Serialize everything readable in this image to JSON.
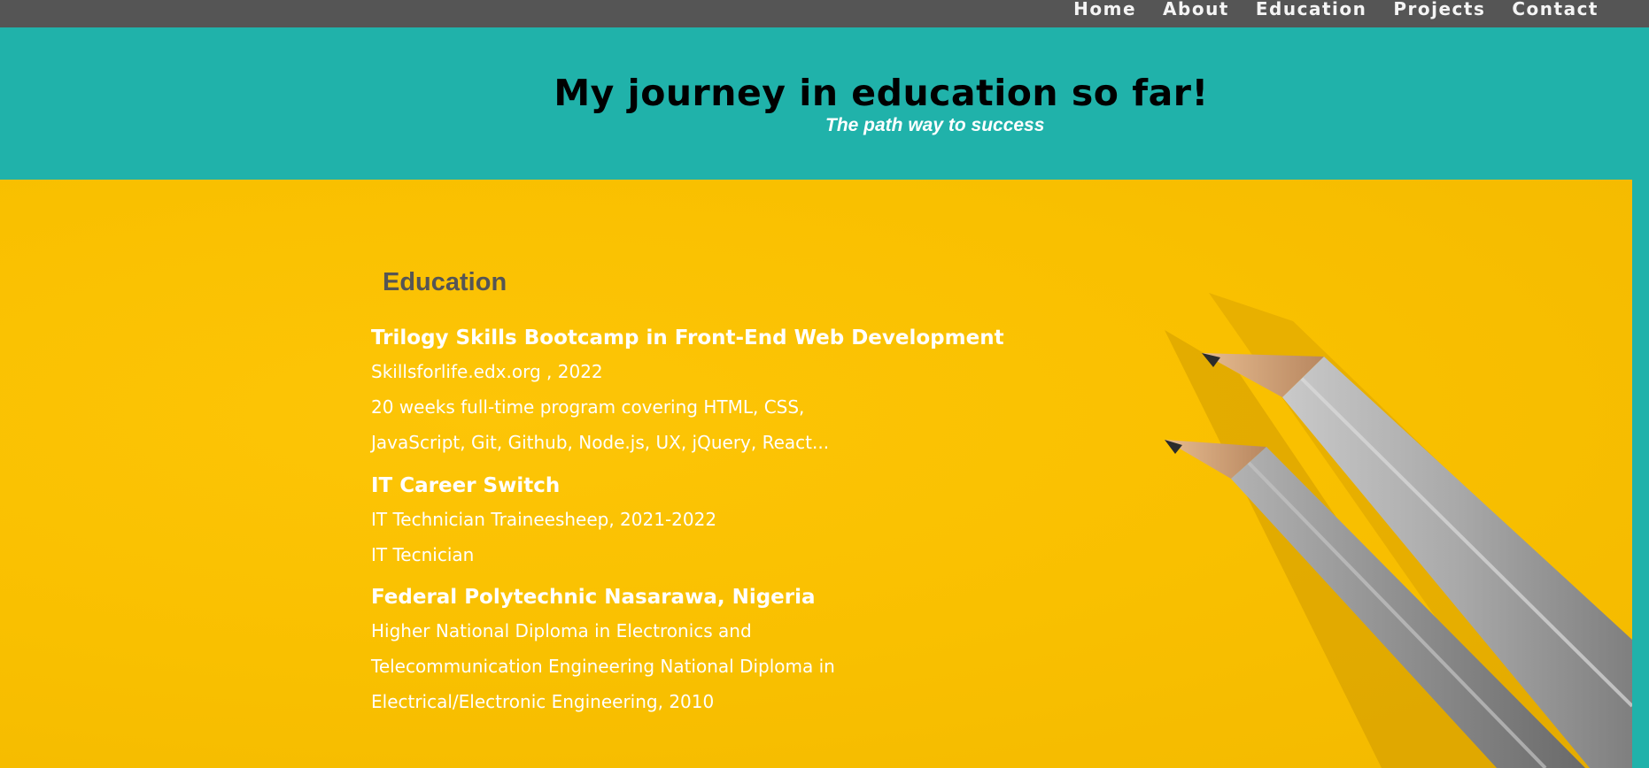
{
  "nav": {
    "items": [
      {
        "label": "Home"
      },
      {
        "label": "About"
      },
      {
        "label": "Education"
      },
      {
        "label": "Projects"
      },
      {
        "label": "Contact"
      }
    ]
  },
  "header": {
    "title": "My journey in education so far!",
    "subtitle": "The path way to success"
  },
  "education": {
    "heading": "Education",
    "entries": [
      {
        "title": "Trilogy Skills Bootcamp in Front-End Web Development",
        "lines": [
          "Skillsforlife.edx.org , 2022",
          "20 weeks full-time program covering HTML, CSS,",
          "JavaScript, Git, Github, Node.js, UX, jQuery, React..."
        ]
      },
      {
        "title": "IT Career Switch",
        "lines": [
          "IT Technician Traineesheep, 2021-2022",
          "IT Tecnician"
        ]
      },
      {
        "title": "Federal Polytechnic Nasarawa, Nigeria",
        "lines": [
          "Higher National Diploma in Electronics and",
          "Telecommunication Engineering National Diploma in",
          "Electrical/Electronic Engineering, 2010"
        ]
      }
    ]
  },
  "colors": {
    "nav_bg": "#555555",
    "header_bg": "#20b2aa",
    "hero_bg": "#f9c000",
    "heading_text": "#555555",
    "body_text": "#ffffff"
  },
  "icons": {
    "hero_image": "pencils-illustration"
  }
}
